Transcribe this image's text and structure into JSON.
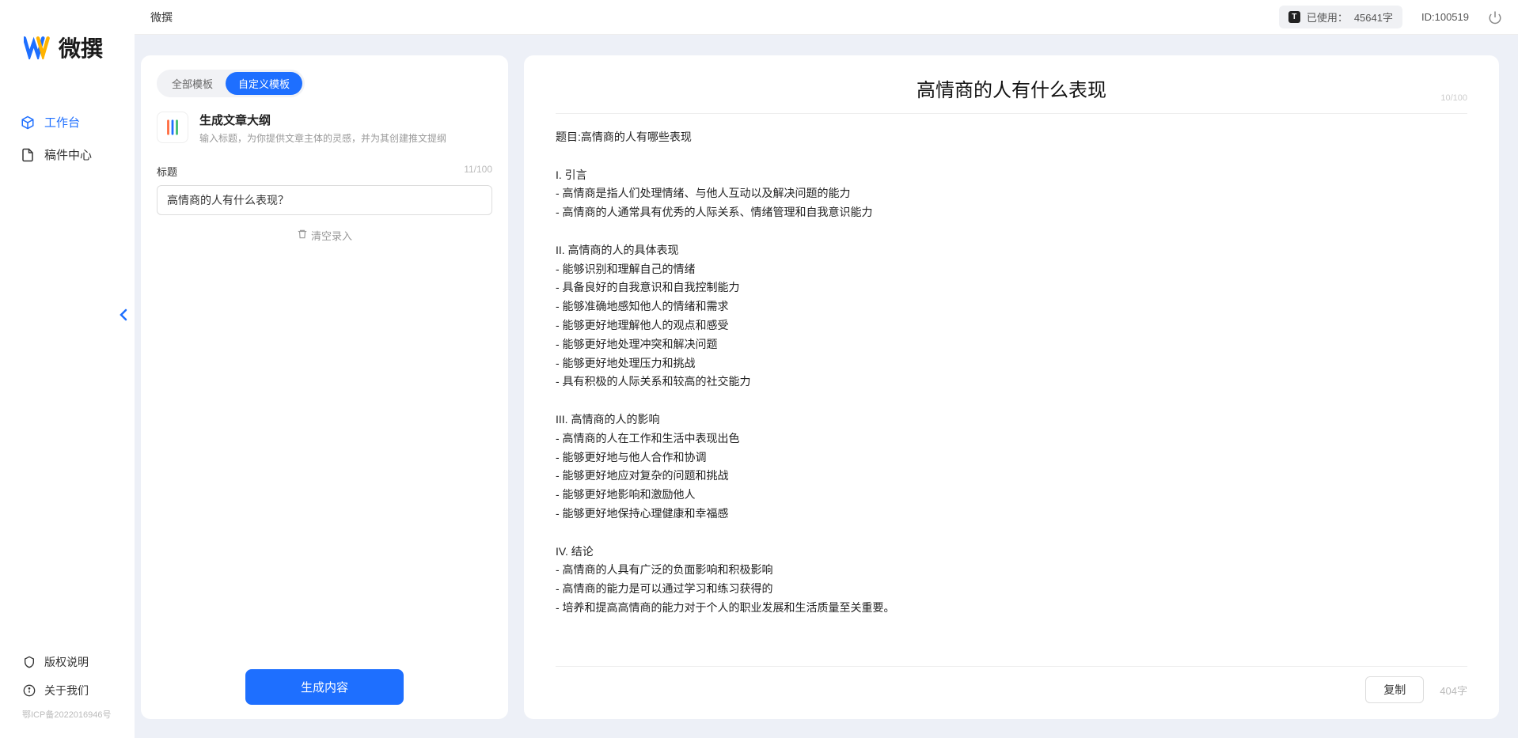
{
  "app": {
    "logo_text": "微撰",
    "title": "微撰"
  },
  "nav": {
    "workbench": "工作台",
    "drafts": "稿件中心"
  },
  "sidebar_footer": {
    "copyright": "版权说明",
    "about": "关于我们",
    "icp": "鄂ICP备2022016946号"
  },
  "topbar": {
    "usage_label": "已使用：",
    "usage_value": "45641字",
    "uid_label": "ID:",
    "uid_value": "100519"
  },
  "tabs": {
    "all": "全部模板",
    "custom": "自定义模板"
  },
  "template": {
    "name": "生成文章大纲",
    "desc": "输入标题，为你提供文章主体的灵感，并为其创建推文提纲"
  },
  "title_field": {
    "label": "标题",
    "counter": "11/100",
    "value": "高情商的人有什么表现？"
  },
  "clear": "清空录入",
  "generate": "生成内容",
  "result": {
    "title": "高情商的人有什么表现",
    "title_counter": "10/100",
    "body": "题目:高情商的人有哪些表现\n\nI. 引言\n- 高情商是指人们处理情绪、与他人互动以及解决问题的能力\n- 高情商的人通常具有优秀的人际关系、情绪管理和自我意识能力\n\nII. 高情商的人的具体表现\n- 能够识别和理解自己的情绪\n- 具备良好的自我意识和自我控制能力\n- 能够准确地感知他人的情绪和需求\n- 能够更好地理解他人的观点和感受\n- 能够更好地处理冲突和解决问题\n- 能够更好地处理压力和挑战\n- 具有积极的人际关系和较高的社交能力\n\nIII. 高情商的人的影响\n- 高情商的人在工作和生活中表现出色\n- 能够更好地与他人合作和协调\n- 能够更好地应对复杂的问题和挑战\n- 能够更好地影响和激励他人\n- 能够更好地保持心理健康和幸福感\n\nIV. 结论\n- 高情商的人具有广泛的负面影响和积极影响\n- 高情商的能力是可以通过学习和练习获得的\n- 培养和提高高情商的能力对于个人的职业发展和生活质量至关重要。",
    "copy": "复制",
    "word_count": "404字"
  }
}
